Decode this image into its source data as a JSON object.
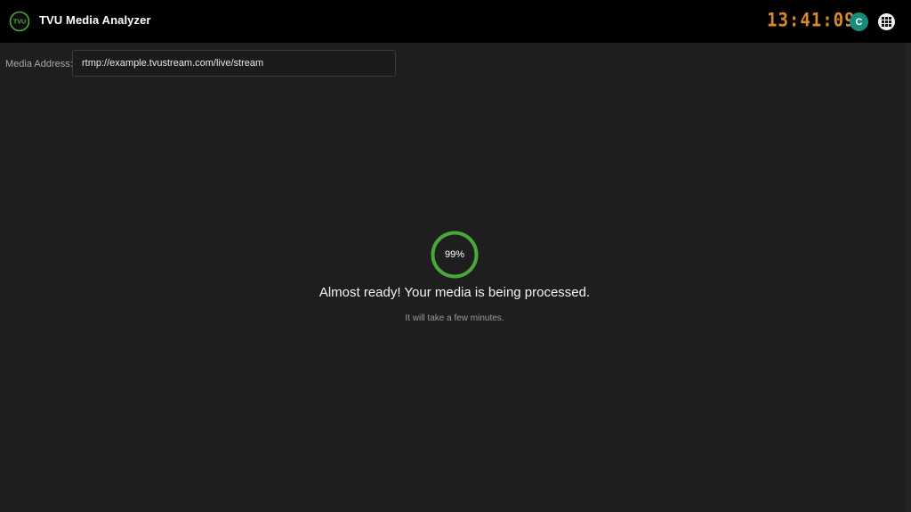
{
  "header": {
    "app_title": "TVU Media Analyzer",
    "logo_text": "TVU",
    "clock": "13:41:09",
    "avatar_initial": "C",
    "icons": {
      "logo": "tvu-logo-icon",
      "apps": "grid-apps-icon"
    }
  },
  "address": {
    "label": "Media Address:",
    "value": "rtmp://example.tvustream.com/live/stream"
  },
  "status": {
    "progress_text": "99%",
    "progress": 0.99,
    "title": "Almost ready! Your media is being processed.",
    "subtitle": "It will take a few minutes."
  },
  "colors": {
    "accent_green": "#4aa83a",
    "clock_orange": "#d98a2c",
    "avatar_teal": "#1a8a7a",
    "header_bg": "#000000",
    "page_bg": "#1e1e1e"
  }
}
